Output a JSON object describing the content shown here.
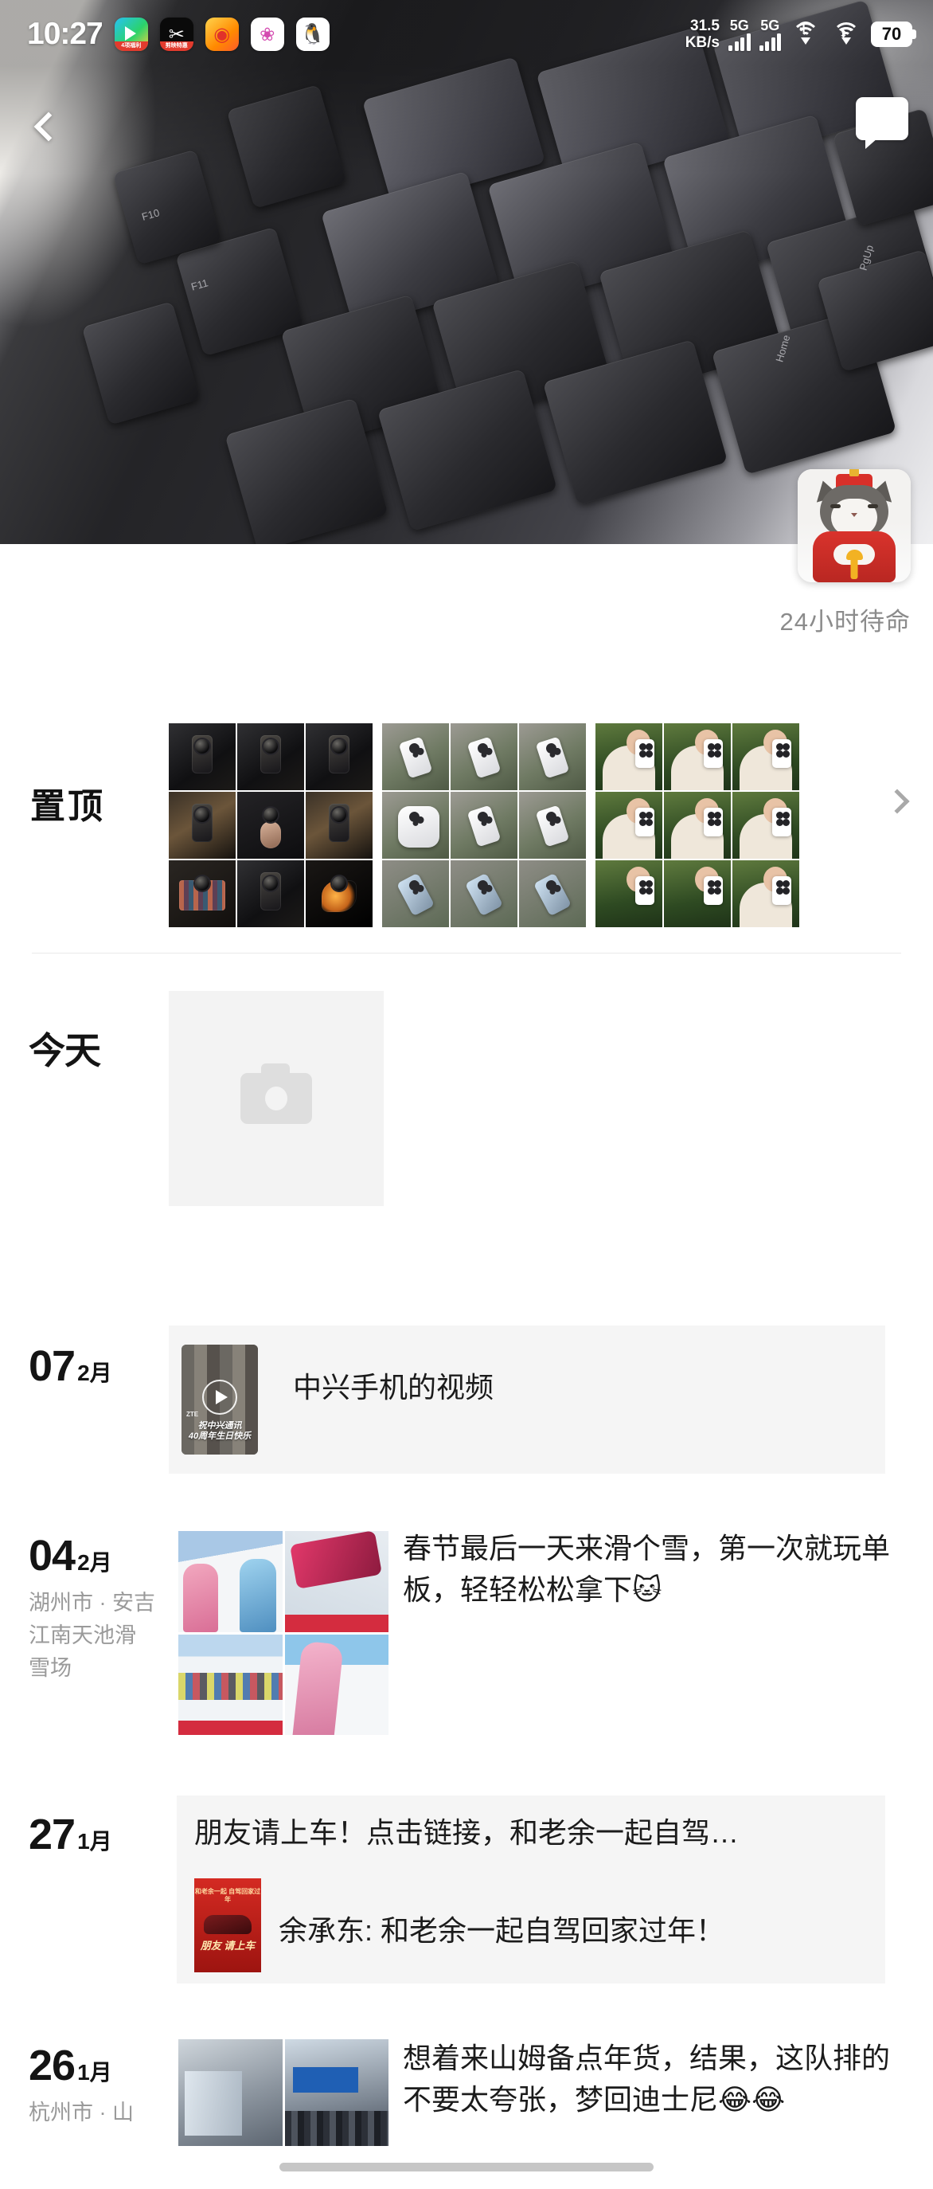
{
  "status_bar": {
    "time": "10:27",
    "app_icons": [
      {
        "name": "tencent-video-icon",
        "badge": "4项福利"
      },
      {
        "name": "capcut-icon",
        "badge": "剪映特惠"
      },
      {
        "name": "weibo-icon",
        "badge": ""
      },
      {
        "name": "color-app-icon",
        "badge": ""
      },
      {
        "name": "qq-icon",
        "badge": ""
      }
    ],
    "net_speed_value": "31.5",
    "net_speed_unit": "KB/s",
    "sim1_label": "5G",
    "sim2_label": "5G",
    "wifi1": "wifi-plus-icon",
    "wifi2": "wifi-transfer-icon",
    "battery": "70"
  },
  "nav": {
    "back_icon": "chevron-left-icon",
    "message_icon": "speech-bubble-icon"
  },
  "profile": {
    "avatar_icon": "cat-avatar",
    "nickname": "24小时待命"
  },
  "pinned": {
    "label": "置顶",
    "arrow_icon": "chevron-right-icon",
    "albums": [
      {
        "name": "black-phone-album",
        "cells": 9
      },
      {
        "name": "white-phone-rocks-album",
        "cells": 9
      },
      {
        "name": "girl-selfie-album",
        "cells": 9
      }
    ]
  },
  "timeline": [
    {
      "id": "today",
      "date_label": "今天",
      "is_today": true,
      "location": "",
      "placeholder_icon": "camera-icon"
    },
    {
      "id": "feb-07",
      "day": "07",
      "month": "2月",
      "location": "",
      "type": "video",
      "text": "中兴手机的视频",
      "video_caption_line1": "祝中兴通讯",
      "video_caption_line2": "40周年生日快乐",
      "video_brand": "ZTE",
      "play_icon": "play-icon"
    },
    {
      "id": "feb-04",
      "day": "04",
      "month": "2月",
      "location": "湖州市 · 安吉江南天池滑雪场",
      "type": "photos",
      "text": "春节最后一天来滑个雪，第一次就玩单板，轻轻松松拿下🐱"
    },
    {
      "id": "jan-27",
      "day": "27",
      "month": "1月",
      "location": "",
      "type": "link",
      "text": "朋友请上车！点击链接，和老余一起自驾…",
      "link_title": "余承东: 和老余一起自驾回家过年！",
      "poster_top": "和老余一起 自驾回家过年",
      "poster_bottom": "朋友 请上车"
    },
    {
      "id": "jan-26",
      "day": "26",
      "month": "1月",
      "location": "杭州市 · 山",
      "type": "photos",
      "text": "想着来山姆备点年货，结果，这队排的不要太夸张，梦回迪士尼😂😂"
    }
  ],
  "home_indicator": "home-indicator-bar"
}
